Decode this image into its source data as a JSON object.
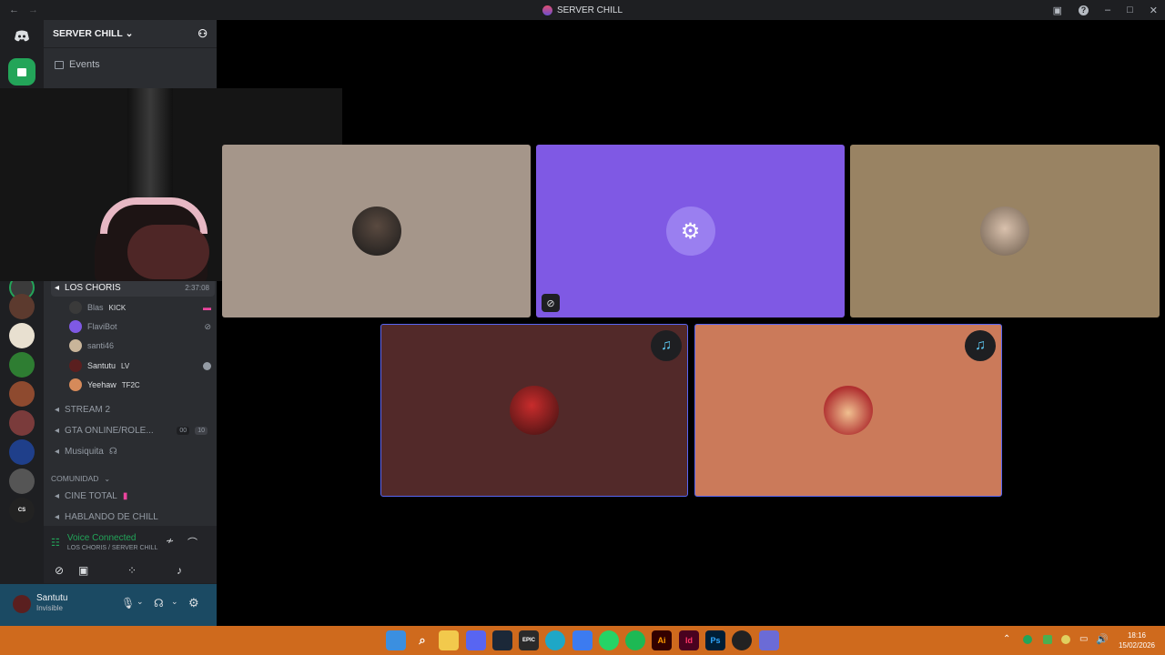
{
  "window": {
    "title": "SERVER CHILL"
  },
  "server": {
    "name": "SERVER CHILL"
  },
  "sidebar": {
    "events_label": "Events",
    "active_channel": {
      "name": "LOS CHORIS",
      "timer": "2:37:08"
    },
    "voice_users": [
      {
        "name": "Blas",
        "tag": "KICK"
      },
      {
        "name": "FlaviBot",
        "tag": ""
      },
      {
        "name": "santi46",
        "tag": ""
      },
      {
        "name": "Santutu",
        "tag": "LV"
      },
      {
        "name": "Yeehaw",
        "tag": "TF2C"
      }
    ],
    "channels": [
      {
        "name": "STREAM 2"
      },
      {
        "name": "GTA ONLINE/ROLE...",
        "count_a": "00",
        "count_b": "10"
      },
      {
        "name": "Musiquita"
      }
    ],
    "category": "COMUNIDAD",
    "channels2": [
      {
        "name": "CINE TOTAL"
      },
      {
        "name": "HABLANDO DE CHILL"
      }
    ]
  },
  "voice": {
    "status": "Voice Connected",
    "location": "LOS CHORIS / SERVER CHILL"
  },
  "user": {
    "name": "Santutu",
    "status": "Invisible"
  },
  "colors": {
    "tile1": "#a5968a",
    "tile2": "#7f59e4",
    "tile3": "#998363",
    "tile4": "#522929",
    "tile5": "#cb7a5a",
    "taskbar": "#cf6a1d"
  },
  "taskbar": {
    "time": "18:16",
    "date": "15/02/2026"
  }
}
